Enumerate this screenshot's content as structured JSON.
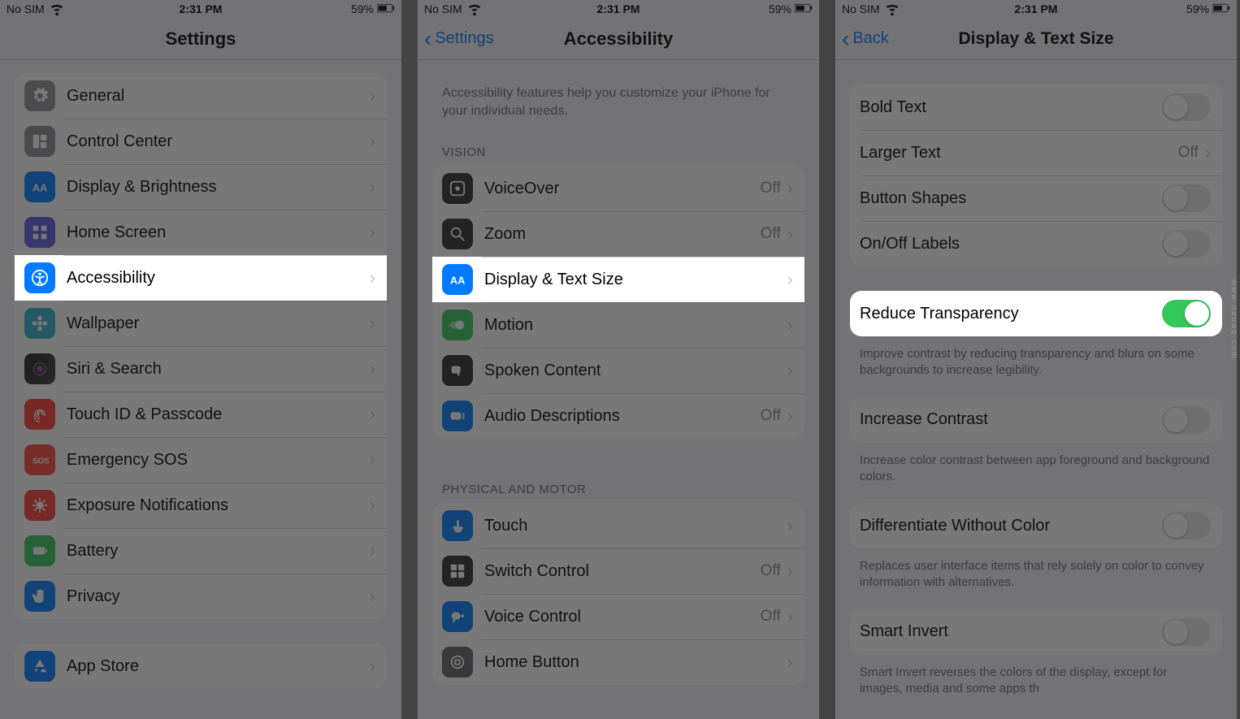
{
  "status": {
    "carrier": "No SIM",
    "time": "2:31 PM",
    "battery": "59%"
  },
  "screens": {
    "settings": {
      "title": "Settings",
      "rows": [
        {
          "icon": "gear",
          "iconClass": "ic-gray",
          "label": "General"
        },
        {
          "icon": "control",
          "iconClass": "ic-gray",
          "label": "Control Center"
        },
        {
          "icon": "aa",
          "iconClass": "ic-blue",
          "label": "Display & Brightness"
        },
        {
          "icon": "grid",
          "iconClass": "ic-indigo",
          "label": "Home Screen"
        },
        {
          "icon": "accessibility",
          "iconClass": "ic-blue",
          "label": "Accessibility",
          "highlight": true
        },
        {
          "icon": "flower",
          "iconClass": "ic-teal",
          "label": "Wallpaper"
        },
        {
          "icon": "siri",
          "iconClass": "ic-siri",
          "label": "Siri & Search"
        },
        {
          "icon": "finger",
          "iconClass": "ic-red",
          "label": "Touch ID & Passcode"
        },
        {
          "icon": "sos",
          "iconClass": "ic-red2",
          "label": "Emergency SOS"
        },
        {
          "icon": "virus",
          "iconClass": "ic-red",
          "label": "Exposure Notifications"
        },
        {
          "icon": "battery",
          "iconClass": "ic-green",
          "label": "Battery"
        },
        {
          "icon": "hand",
          "iconClass": "ic-blue",
          "label": "Privacy"
        }
      ],
      "group2": [
        {
          "icon": "appstore",
          "iconClass": "ic-blue",
          "label": "App Store"
        }
      ]
    },
    "accessibility": {
      "backLabel": "Settings",
      "title": "Accessibility",
      "hint": "Accessibility features help you customize your iPhone for your individual needs.",
      "section1_header": "VISION",
      "section1": [
        {
          "icon": "voiceover",
          "iconClass": "ic-black",
          "label": "VoiceOver",
          "value": "Off"
        },
        {
          "icon": "zoom",
          "iconClass": "ic-black",
          "label": "Zoom",
          "value": "Off"
        },
        {
          "icon": "aa",
          "iconClass": "ic-blue",
          "label": "Display & Text Size",
          "highlight": true
        },
        {
          "icon": "motion",
          "iconClass": "ic-green",
          "label": "Motion"
        },
        {
          "icon": "spoken",
          "iconClass": "ic-black",
          "label": "Spoken Content"
        },
        {
          "icon": "audiodesc",
          "iconClass": "ic-blue",
          "label": "Audio Descriptions",
          "value": "Off"
        }
      ],
      "section2_header": "PHYSICAL AND MOTOR",
      "section2": [
        {
          "icon": "touch",
          "iconClass": "ic-blue",
          "label": "Touch"
        },
        {
          "icon": "switch",
          "iconClass": "ic-black",
          "label": "Switch Control",
          "value": "Off"
        },
        {
          "icon": "voice",
          "iconClass": "ic-blue",
          "label": "Voice Control",
          "value": "Off"
        },
        {
          "icon": "home",
          "iconClass": "ic-darkgray",
          "label": "Home Button"
        }
      ]
    },
    "display_text": {
      "backLabel": "Back",
      "title": "Display & Text Size",
      "rows1": [
        {
          "label": "Bold Text",
          "type": "toggle",
          "on": false
        },
        {
          "label": "Larger Text",
          "type": "link",
          "value": "Off"
        },
        {
          "label": "Button Shapes",
          "type": "toggle",
          "on": false
        },
        {
          "label": "On/Off Labels",
          "type": "toggle",
          "on": false
        }
      ],
      "rows2": [
        {
          "label": "Reduce Transparency",
          "type": "toggle",
          "on": true,
          "highlight": true
        }
      ],
      "footer2": "Improve contrast by reducing transparency and blurs on some backgrounds to increase legibility.",
      "rows3": [
        {
          "label": "Increase Contrast",
          "type": "toggle",
          "on": false
        }
      ],
      "footer3": "Increase color contrast between app foreground and background colors.",
      "rows4": [
        {
          "label": "Differentiate Without Color",
          "type": "toggle",
          "on": false
        }
      ],
      "footer4": "Replaces user interface items that rely solely on color to convey information with alternatives.",
      "rows5": [
        {
          "label": "Smart Invert",
          "type": "toggle",
          "on": false
        }
      ],
      "footer5": "Smart Invert reverses the colors of the display, except for images, media and some apps th"
    }
  },
  "watermark": "www.deuaq.com"
}
